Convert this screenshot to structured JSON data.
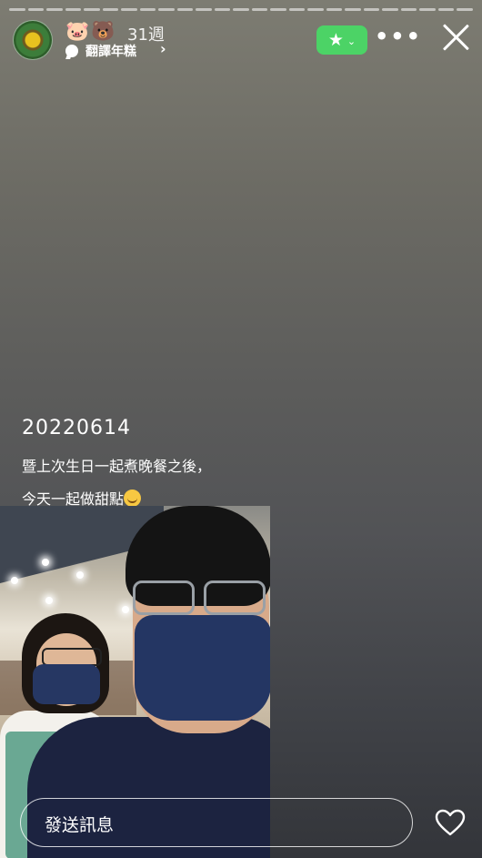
{
  "story": {
    "segments": 25,
    "emojis": "🐷🐻",
    "weeks_label": "31週",
    "subtitle": "翻譯年糕",
    "chevron": "›",
    "more_label": "•••"
  },
  "caption": {
    "date": "20220614",
    "line1": "暨上次生日一起煮晚餐之後，",
    "line2": "今天一起做甜點"
  },
  "reply": {
    "placeholder": "發送訊息"
  },
  "colors": {
    "accent_green": "#4cd366",
    "mask_navy": "#243663"
  }
}
